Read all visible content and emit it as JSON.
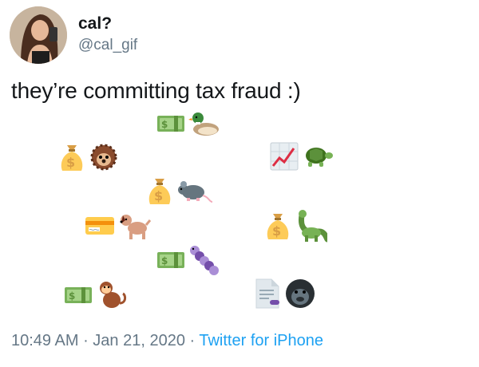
{
  "author": {
    "display_name": "cal?",
    "handle": "@cal_gif",
    "avatar_icon": "user-avatar-photo"
  },
  "tweet": {
    "text": "they’re committing tax fraud :)"
  },
  "emoji_pairs": [
    {
      "left": "dollar-banknote",
      "right": "duck"
    },
    {
      "left": "money-bag",
      "right": "hedgehog"
    },
    {
      "left": "chart-increasing",
      "right": "turtle"
    },
    {
      "left": "money-bag",
      "right": "rat"
    },
    {
      "left": "credit-card",
      "right": "dog"
    },
    {
      "left": "money-bag",
      "right": "sauropod"
    },
    {
      "left": "dollar-banknote",
      "right": "caterpillar"
    },
    {
      "left": "dollar-banknote",
      "right": "monkey"
    },
    {
      "left": "page-facing-up",
      "right": "gorilla"
    }
  ],
  "footer": {
    "time": "10:49 AM",
    "separator": " · ",
    "date": "Jan 21, 2020",
    "source": "Twitter for iPhone"
  },
  "colors": {
    "text": "#14171a",
    "secondary": "#657786",
    "link": "#1da1f2"
  }
}
